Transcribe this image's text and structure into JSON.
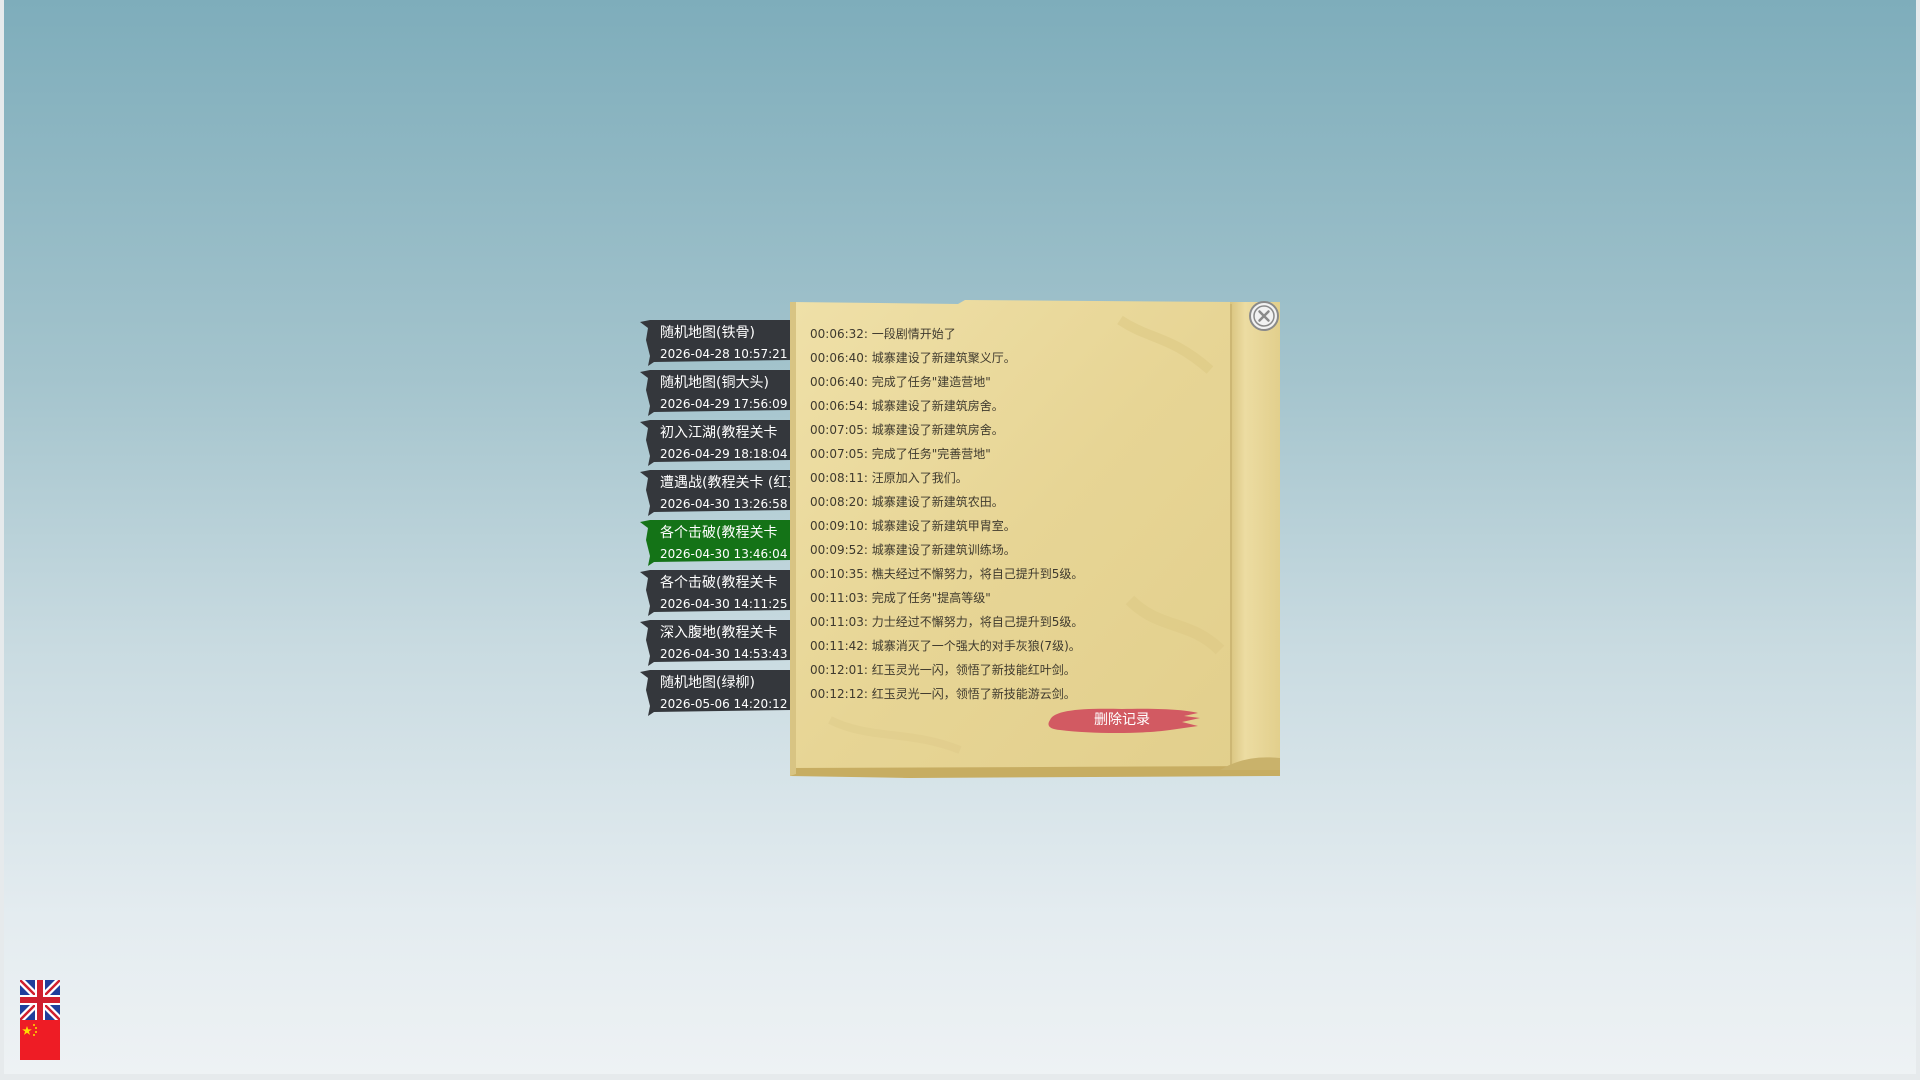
{
  "colors": {
    "tab_default": "#34373c",
    "tab_selected": "#147317",
    "parchment": "#e8d698",
    "parchment_edge": "#c9b26b",
    "delete_button": "#d25a62",
    "log_text": "#3f3a2e"
  },
  "saves": [
    {
      "name": "随机地图(铁骨)",
      "time": "2026-04-28 10:57:21",
      "selected": false
    },
    {
      "name": "随机地图(铜大头)",
      "time": "2026-04-29 17:56:09",
      "selected": false
    },
    {
      "name": "初入江湖(教程关卡",
      "time": "2026-04-29 18:18:04",
      "selected": false
    },
    {
      "name": "遭遇战(教程关卡 (红玉",
      "time": "2026-04-30 13:26:58",
      "selected": false
    },
    {
      "name": "各个击破(教程关卡",
      "time": "2026-04-30 13:46:04",
      "selected": true
    },
    {
      "name": "各个击破(教程关卡",
      "time": "2026-04-30 14:11:25",
      "selected": false
    },
    {
      "name": "深入腹地(教程关卡",
      "time": "2026-04-30 14:53:43",
      "selected": false
    },
    {
      "name": "随机地图(绿柳)",
      "time": "2026-05-06 14:20:12",
      "selected": false
    }
  ],
  "log": [
    "00:06:32: 一段剧情开始了",
    "00:06:40: 城寨建设了新建筑聚义厅。",
    "00:06:40: 完成了任务\"建造营地\"",
    "00:06:54: 城寨建设了新建筑房舍。",
    "00:07:05: 城寨建设了新建筑房舍。",
    "00:07:05: 完成了任务\"完善营地\"",
    "00:08:11: 汪原加入了我们。",
    "00:08:20: 城寨建设了新建筑农田。",
    "00:09:10: 城寨建设了新建筑甲胄室。",
    "00:09:52: 城寨建设了新建筑训练场。",
    "00:10:35: 樵夫经过不懈努力，将自己提升到5级。",
    "00:11:03: 完成了任务\"提高等级\"",
    "00:11:03: 力士经过不懈努力，将自己提升到5级。",
    "00:11:42: 城寨消灭了一个强大的对手灰狼(7级)。",
    "00:12:01: 红玉灵光一闪，领悟了新技能红叶剑。",
    "00:12:12: 红玉灵光一闪，领悟了新技能游云剑。"
  ],
  "delete_button": {
    "label": "删除记录"
  },
  "close_icon": "close-circle-icon",
  "languages": [
    {
      "icon": "uk-flag-icon"
    },
    {
      "icon": "china-flag-icon"
    }
  ]
}
